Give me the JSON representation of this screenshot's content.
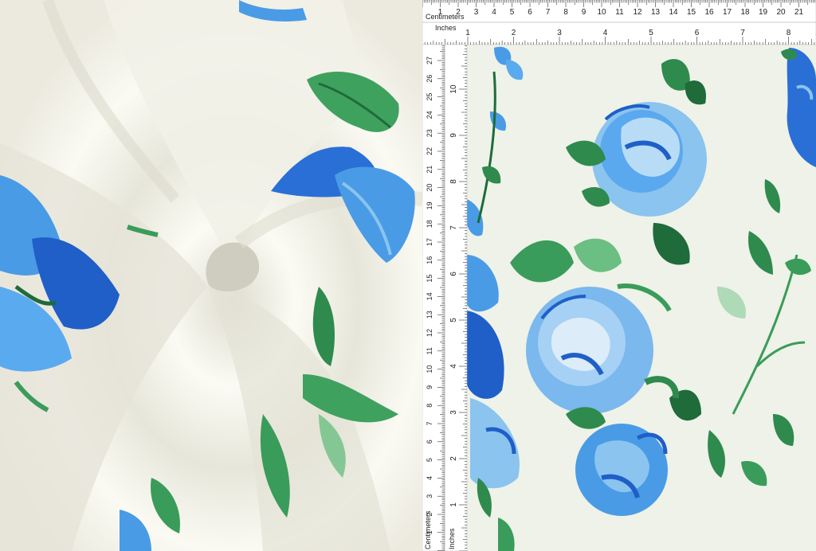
{
  "ruler": {
    "centimeters_label": "Centimeters",
    "inches_label": "Inches",
    "top_cm": [
      "1",
      "2",
      "3",
      "4",
      "5",
      "6",
      "7",
      "8",
      "9",
      "10",
      "11",
      "12",
      "13",
      "14",
      "15",
      "16",
      "17",
      "18",
      "19",
      "20",
      "21"
    ],
    "top_in": [
      "1",
      "2",
      "3",
      "4",
      "5",
      "6",
      "7",
      "8"
    ],
    "side_cm": [
      "27",
      "26",
      "25",
      "24",
      "23",
      "22",
      "21",
      "20",
      "19",
      "18",
      "17",
      "16",
      "15",
      "14",
      "13",
      "12",
      "11",
      "10",
      "9",
      "8",
      "7",
      "6",
      "5",
      "4",
      "3",
      "2",
      "1"
    ],
    "side_in": [
      "10",
      "9",
      "8",
      "7",
      "6",
      "5",
      "4",
      "3",
      "2",
      "1"
    ]
  },
  "colors": {
    "fabric": "#f7f7f0",
    "rose_light": "#8ac4ef",
    "rose_mid": "#4a9be6",
    "rose_dark": "#1f5fc7",
    "leaf": "#3a9c5a",
    "leaf_dark": "#1f6b3a",
    "ruler_bg": "#ffffff",
    "ruler_ink": "#222222"
  }
}
